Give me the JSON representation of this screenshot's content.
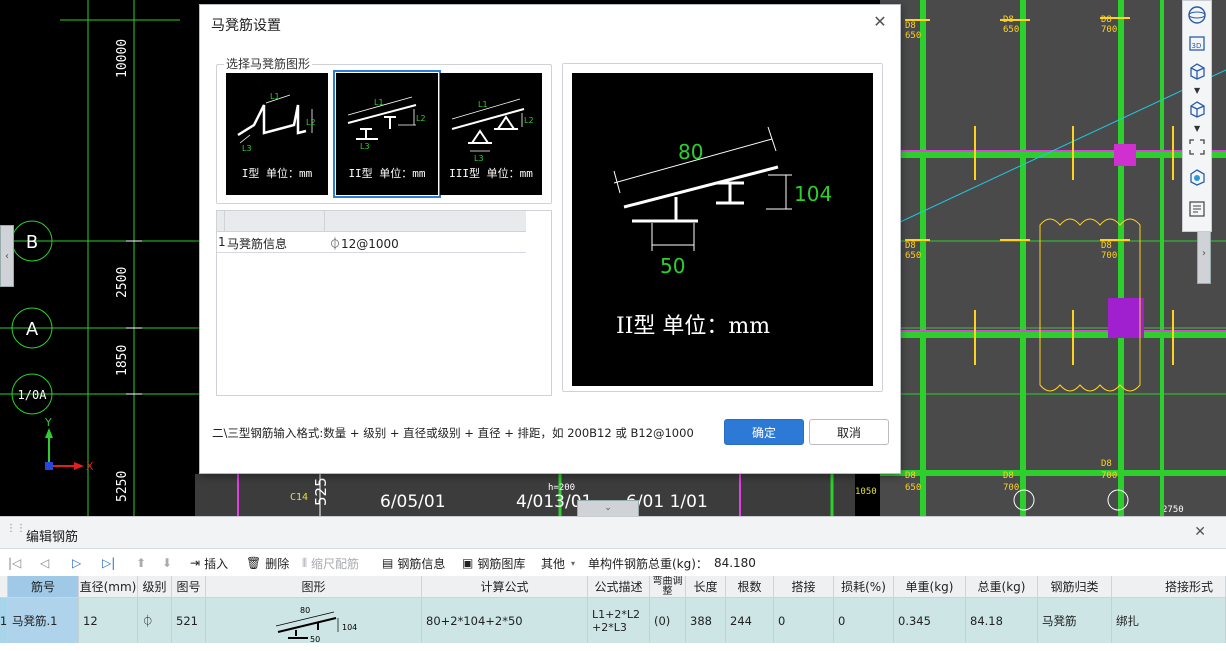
{
  "cad": {
    "axis_labels": [
      "B",
      "A",
      "1/0A"
    ],
    "dimensions": [
      "10000",
      "2500",
      "1850",
      "5250"
    ],
    "ucs": {
      "x": "X",
      "y": "Y"
    },
    "bottom_labels": [
      "6/05/01",
      "4/013/01",
      "6/01 1/01"
    ],
    "section_labels": [
      "D8",
      "650",
      "D8",
      "700",
      "D8",
      "650",
      "D8",
      "700",
      "D8",
      "650",
      "D8",
      "700",
      "D8",
      "650",
      "D8",
      "700"
    ],
    "misc_labels": [
      "h=200",
      "2750",
      "C14",
      "525",
      "1050"
    ]
  },
  "view_toolbar": {
    "icons": [
      "sphere-icon",
      "3d-icon",
      "cube-icon",
      "chevron-down-icon",
      "cube-outline-icon",
      "chevron-down-icon",
      "fullscreen-icon",
      "isometric-icon",
      "properties-icon"
    ]
  },
  "dialog": {
    "title": "马凳筋设置",
    "group_label": "选择马凳筋图形",
    "shapes": [
      {
        "caption": "I型 单位：mm",
        "labels": [
          "L1",
          "L2",
          "L3"
        ]
      },
      {
        "caption": "II型 单位：mm",
        "labels": [
          "L1",
          "L2",
          "L3"
        ]
      },
      {
        "caption": "III型 单位：mm",
        "labels": [
          "L1",
          "L2",
          "L3"
        ]
      }
    ],
    "selected_shape": 1,
    "table": {
      "rows": [
        {
          "num": "1",
          "name": "马凳筋信息",
          "value": "⏀12@1000"
        }
      ]
    },
    "preview": {
      "caption": "II型 单位：mm",
      "l1": "80",
      "l2": "104",
      "l3": "50"
    },
    "hint": "二\\三型钢筋输入格式:数量 + 级别 + 直径或级别 + 直径 + 排距，如 200B12 或 B12@1000",
    "ok_label": "确定",
    "cancel_label": "取消"
  },
  "panel": {
    "title": "编辑钢筋",
    "toolbar": {
      "insert": "插入",
      "delete": "删除",
      "scale": "缩尺配筋",
      "info": "钢筋信息",
      "library": "钢筋图库",
      "other": "其他",
      "total_label": "单构件钢筋总重(kg)：",
      "total_value": "84.180"
    },
    "columns": [
      "筋号",
      "直径(mm)",
      "级别",
      "图号",
      "图形",
      "计算公式",
      "公式描述",
      "弯曲调整",
      "长度",
      "根数",
      "搭接",
      "损耗(%)",
      "单重(kg)",
      "总重(kg)",
      "钢筋归类",
      "搭接形式"
    ],
    "rows": [
      {
        "rownum": "1",
        "name": "马凳筋.1",
        "diameter": "12",
        "grade": "⏀",
        "figure_no": "521",
        "shape_l1": "80",
        "shape_l2": "104",
        "shape_l3": "50",
        "formula": "80+2*104+2*50",
        "formula_desc": "L1+2*L2+2*L3",
        "bend_adjust": "(0)",
        "length": "388",
        "count": "244",
        "lap": "0",
        "loss": "0",
        "unit_weight": "0.345",
        "total_weight": "84.18",
        "category": "马凳筋",
        "lap_type": "绑扎"
      }
    ]
  }
}
